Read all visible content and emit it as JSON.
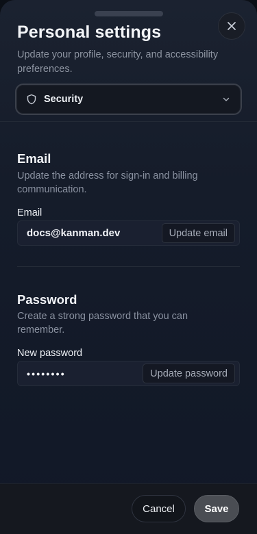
{
  "sheet": {
    "title": "Personal settings",
    "subtitle": "Update your profile, security, and accessibility preferences."
  },
  "close": {
    "icon": "close-icon"
  },
  "section_select": {
    "icon": "shield-icon",
    "selected": "Security",
    "chevron": "chevron-down-icon"
  },
  "email_section": {
    "title": "Email",
    "description": "Update the address for sign-in and billing communication.",
    "field_label": "Email",
    "value": "docs@kanman.dev",
    "action_label": "Update email"
  },
  "password_section": {
    "title": "Password",
    "description": "Create a strong password that you can remember.",
    "field_label": "New password",
    "value": "••••••••",
    "action_label": "Update password"
  },
  "footer": {
    "cancel_label": "Cancel",
    "save_label": "Save"
  }
}
